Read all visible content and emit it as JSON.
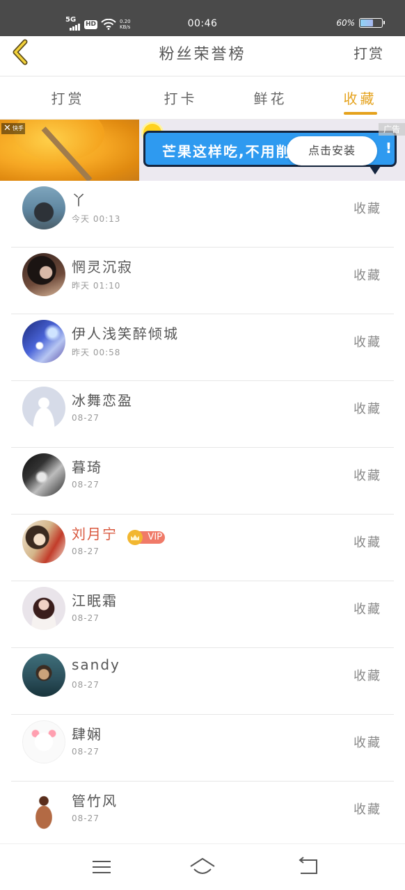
{
  "status_bar": {
    "network": "5G",
    "hd": "HD",
    "speed_value": "0.20",
    "speed_unit": "KB/s",
    "time": "00:46",
    "battery_text": "60%",
    "battery_level": 0.6
  },
  "header": {
    "title": "粉丝荣誉榜",
    "action": "打赏"
  },
  "tabs": [
    {
      "label": "打赏",
      "active": false
    },
    {
      "label": "打卡",
      "active": false
    },
    {
      "label": "鲜花",
      "active": false
    },
    {
      "label": "收藏",
      "active": true
    }
  ],
  "ad": {
    "close_label": "快手",
    "tag": "广告",
    "headline": "芒果这样吃,不用削皮",
    "headline_tail": "!",
    "install_button": "点击安装"
  },
  "fans": [
    {
      "name": "丫",
      "time": "今天 00:13",
      "action": "收藏",
      "vip": false
    },
    {
      "name": "惘灵沉寂",
      "time": "昨天 01:10",
      "action": "收藏",
      "vip": false
    },
    {
      "name": "伊人浅笑醉倾城",
      "time": "昨天 00:58",
      "action": "收藏",
      "vip": false
    },
    {
      "name": "冰舞恋盈",
      "time": "08-27",
      "action": "收藏",
      "vip": false
    },
    {
      "name": "暮琦",
      "time": "08-27",
      "action": "收藏",
      "vip": false
    },
    {
      "name": "刘月宁",
      "time": "08-27",
      "action": "收藏",
      "vip": true,
      "vip_label": "VIP"
    },
    {
      "name": "江眠霜",
      "time": "08-27",
      "action": "收藏",
      "vip": false
    },
    {
      "name": "sandy",
      "time": "08-27",
      "action": "收藏",
      "vip": false
    },
    {
      "name": "肆娴",
      "time": "08-27",
      "action": "收藏",
      "vip": false
    },
    {
      "name": "管竹风",
      "time": "08-27",
      "action": "收藏",
      "vip": false
    }
  ],
  "colors": {
    "accent": "#e5a21c",
    "vip_name": "#d9583e",
    "status_bar_bg": "#4a4a4a"
  },
  "icons": {
    "back": "chevron-left-icon",
    "menu": "menu-icon",
    "home": "home-icon",
    "back_nav": "back-icon"
  }
}
